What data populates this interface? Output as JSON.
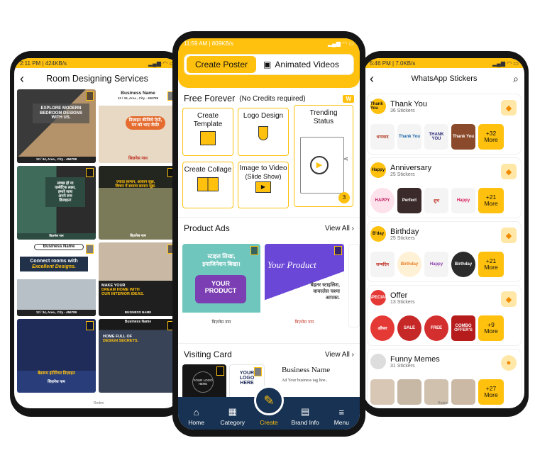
{
  "left": {
    "status": {
      "time": "2:11 PM | 424KB/s",
      "icons": "signal wifi battery"
    },
    "title": "Room Designing Services",
    "cards": [
      {
        "l1": "EXPLORE MODERN",
        "l2": "BEDROOM DESIGNS",
        "l3": "WITH US.",
        "footer": "12 / 34, Area , City - 456789"
      },
      {
        "header": "Business Name",
        "sub": "12 / 34, Area , City - 456789",
        "l1": "डिज़ाइन कीजिये ऐसी,",
        "l2": "मन को भाए जैसी!",
        "footer": "बिज़नेस नाम"
      },
      {
        "l1": "स्वच्छ हो या",
        "l2": "एस्थेटिक लक्ष्य,",
        "l3": "हमारे साथ",
        "l4": "अपने रूम",
        "l5": "डिजाइन!",
        "footer": "बिज़नेस नाम"
      },
      {
        "l1": "ज्यादा सामान, आसान सूझ,",
        "l2": "किचन में समाया सामान सूझ.",
        "footer": "बिज़नेस नाम"
      },
      {
        "header": "Business Name",
        "l1": "Connect rooms with",
        "l2": "Excellent Designs.",
        "footer": "12 / 34, Area , City - 456789"
      },
      {
        "l1": "MAKE YOUR",
        "l2": "DREAM HOME WITH",
        "l3": "OUR INTERIOR IDEAS.",
        "footer": "BUSINESS NAME"
      },
      {
        "l1": "बेडरूम इंटीरियर डिज़ाइन",
        "footer": "बिज़नेस नाम"
      },
      {
        "header": "Business Name",
        "l1": "HOME FULL OF",
        "l2": "DESIGN SECRETS."
      }
    ]
  },
  "middle": {
    "status": {
      "time": "11:59 AM | 809KB/s",
      "icons": "signal wifi battery"
    },
    "tabs": {
      "active": "Create Poster",
      "other": "Animated Videos"
    },
    "free": {
      "title": "Free Forever",
      "note": "(No Credits required)",
      "badge": "W"
    },
    "options": [
      {
        "label": "Create Template"
      },
      {
        "label": "Logo Design"
      },
      {
        "label": "Trending Status",
        "count": "3"
      },
      {
        "label": "Create Collage"
      },
      {
        "label": "Image to Video",
        "sub": "(Slide Show)"
      }
    ],
    "product_ads": {
      "title": "Product Ads",
      "view_all": "View All"
    },
    "ads": [
      {
        "l1": "स्टाइल लिखा,",
        "l2": "इमाजिनेशन बिखा।",
        "product": "YOUR PRODUCT",
        "footer": "बिज़नेस नाम"
      },
      {
        "script": "Your Product",
        "l1": "बेहतर स्टाइलिश,",
        "l2": "वायरलेस चश्मा",
        "l3": "आपका.",
        "footer": "बिज़नेस नाम"
      }
    ],
    "visiting": {
      "title": "Visiting Card",
      "view_all": "View All"
    },
    "cards": [
      {
        "logo": "YOUR LOGO HERE"
      },
      {
        "logo": "YOUR LOGO HERE"
      },
      {
        "name": "Business Name",
        "tagline": "Ad Your business tag line.."
      }
    ],
    "nav": {
      "home": "Home",
      "category": "Category",
      "create": "Create",
      "brand": "Brand Info",
      "menu": "Menu"
    }
  },
  "right": {
    "status": {
      "time": "5:46 PM | 7.0KB/s",
      "icons": "signal wifi battery"
    },
    "title": "WhatsApp Stickers",
    "sections": [
      {
        "name": "Thank You",
        "count": "36 Stickers",
        "logo": "Thank You",
        "stickers": [
          "धन्यवाद",
          "Thank You",
          "THANK YOU",
          "Thank You"
        ],
        "more": "+32",
        "more_label": "More"
      },
      {
        "name": "Anniversary",
        "count": "25 Stickers",
        "logo": "Happy",
        "stickers": [
          "HAPPY",
          "Perfect",
          "शुभ",
          "Happy"
        ],
        "more": "+21",
        "more_label": "More"
      },
      {
        "name": "Birthday",
        "count": "25 Stickers",
        "logo": "B'day",
        "stickers": [
          "जन्मदिन",
          "Birthday",
          "Happy",
          "Birthday"
        ],
        "more": "+21",
        "more_label": "More"
      },
      {
        "name": "Offer",
        "count": "13 Stickers",
        "logo": "SPECIAL",
        "stickers": [
          "ऑफर",
          "SALE",
          "FREE",
          "COMBO OFFER'S"
        ],
        "more": "+9",
        "more_label": "More"
      },
      {
        "name": "Funny Memes",
        "count": "31 Stickers",
        "logo": "",
        "stickers": [
          "",
          "",
          "",
          ""
        ],
        "more": "+27",
        "more_label": "More"
      }
    ]
  }
}
